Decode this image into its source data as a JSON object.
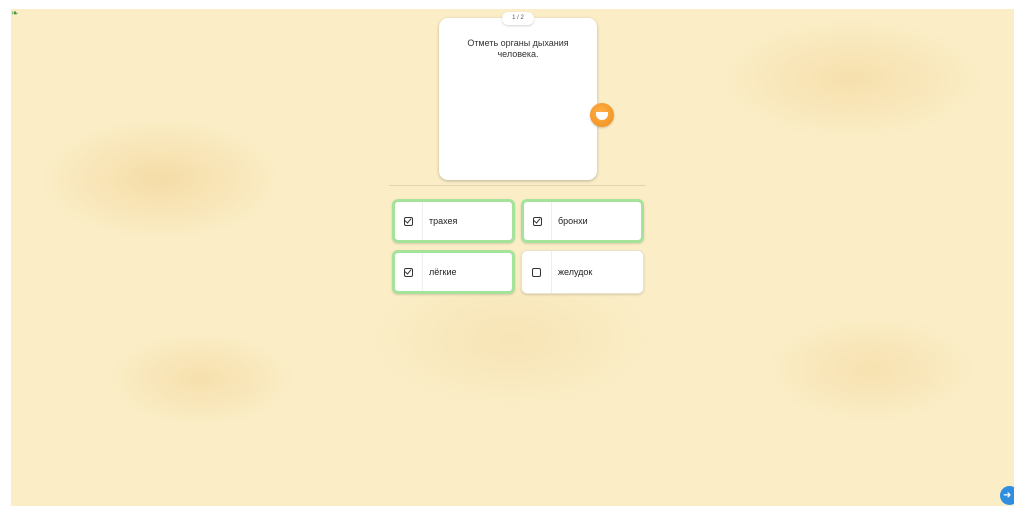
{
  "progress": {
    "label": "1 / 2"
  },
  "question": {
    "text": "Отметь органы дыхания человека."
  },
  "options": [
    {
      "label": "трахея",
      "checked": true
    },
    {
      "label": "бронхи",
      "checked": true
    },
    {
      "label": "лёгкие",
      "checked": true
    },
    {
      "label": "желудок",
      "checked": false
    }
  ],
  "icons": {
    "corner": "sprout-icon",
    "mascot": "smiley-mascot-icon",
    "checked_box": "checked-checkbox-icon",
    "unchecked_box": "empty-checkbox-icon",
    "next": "arrow-right-icon"
  },
  "colors": {
    "background": "#fbeec7",
    "selected_border": "#a6e39a",
    "next_button": "#2f8ee0",
    "mascot": "#f5961e"
  }
}
